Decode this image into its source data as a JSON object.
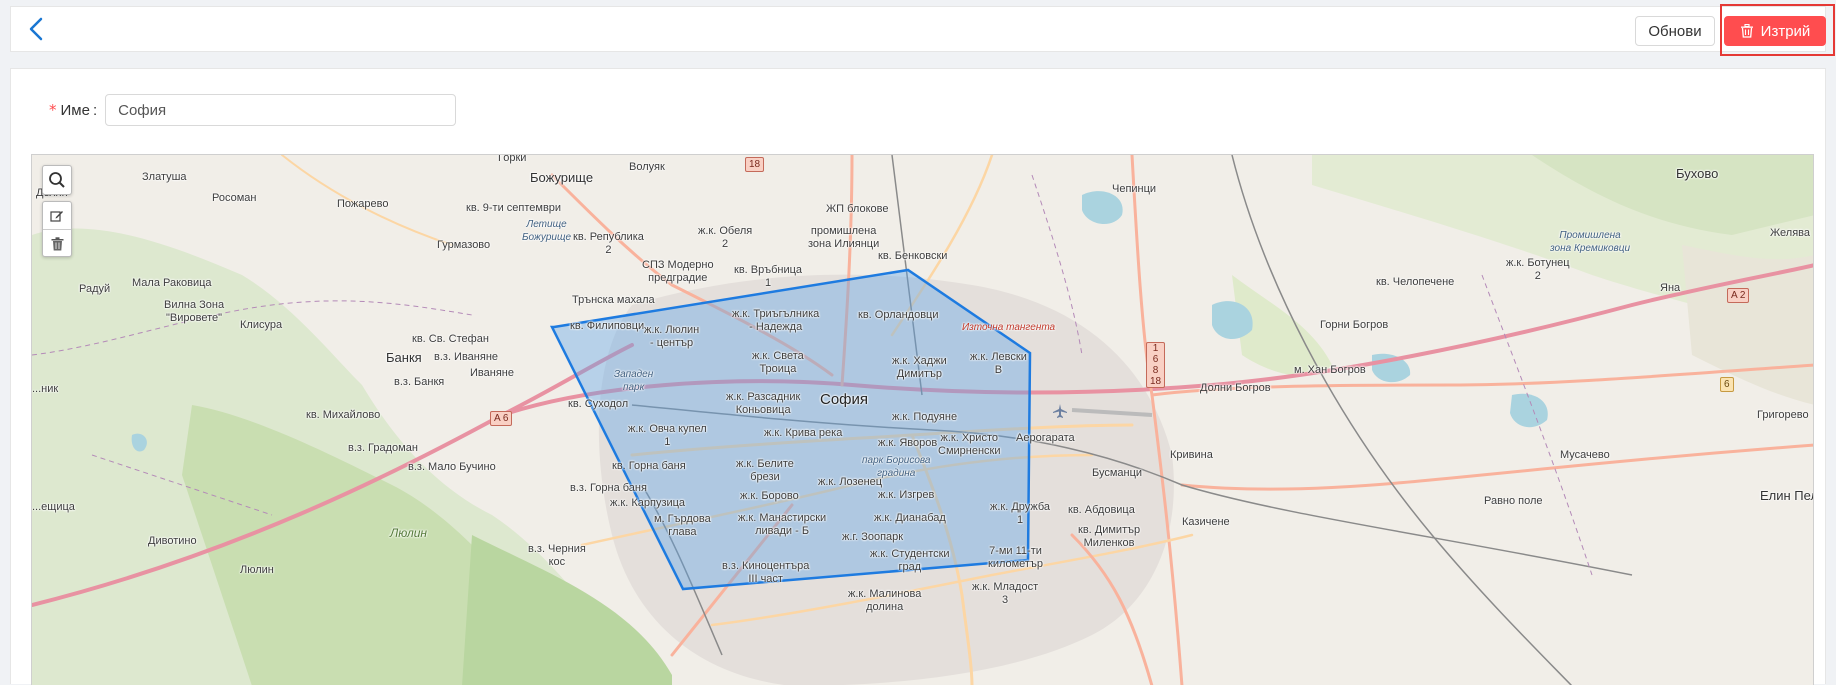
{
  "header": {
    "refresh_label": "Обнови",
    "delete_label": "Изтрий"
  },
  "form": {
    "name_label": "Име",
    "name_required_mark": "*",
    "name_value": "София"
  },
  "map": {
    "labels": {
      "gorki": "Горки",
      "volyak": "Волуяк",
      "bozhurishte": "Божурище",
      "zlatusha": "Златуша",
      "rosoman": "Росоман",
      "pozharevo": "Пожарево",
      "kv9sept": "кв. 9-ти септември",
      "letishte": "Летище\nБожурище",
      "republika": "кв. Република\n2",
      "gurmazovo": "Гурмазово",
      "delyan": "Делян",
      "malaRakovitsa": "Мала Раковица",
      "raduy": "Радуй",
      "vilnaZona": "Вилна Зона\n\"Вировете\"",
      "klisura": "Клисура",
      "trunskaMahala": "Трънска махала",
      "obelya2": "ж.к. Обеля\n2",
      "spzModerno": "СПЗ Модерно\nпредградие",
      "vrabnitsa": "кв. Връбница\n1",
      "promIliyantsi": "промишлена\nзона Илиянци",
      "zhpBlokove": "ЖП блокове",
      "benkovski": "кв. Бенковски",
      "chepintsi": "Чепинци",
      "buhovo": "Бухово",
      "zhelyava": "Желява",
      "promKremikovtsi": "Промишлена\nзона Кремиковци",
      "botunets": "ж.к. Ботунец\n2",
      "chelopechene": "кв. Челопечене",
      "yana": "Яна",
      "filipovtsi": "кв. Филиповци",
      "lyulin": "ж.к. Люлин\n- център",
      "trigalnika": "ж.к. Триъгълника\n- Надежда",
      "orlandovtsi": "кв. Орландовци",
      "iztochnaTangenta": "Източна тангента",
      "stStefan": "кв. Св. Стефан",
      "banka": "Банкя",
      "ivanyane": "в.з. Иваняне",
      "ivanyane2": "Иваняне",
      "vzBanka": "в.з. Банкя",
      "sveta": "ж.к. Света\nТроица",
      "hadzhi": "ж.к. Хаджи\nДимитър",
      "levski": "ж.к. Левски\nВ",
      "gorniBogrov": "Горни Богров",
      "hanBogrov": "м. Хан Богров",
      "zapaden": "Западен\nпарк",
      "sofia": "София",
      "razsadnik": "ж.к. Разсадник\nКоньовица",
      "suhodol": "кв. Суходол",
      "mihaylovo": "кв. Михайлово",
      "dolniBogrov": "Долни Богров",
      "grigorevo": "Григорево",
      "poduyane": "ж.к. Подуяне",
      "ovcha": "ж.к. Овча купел\n1",
      "kriva": "ж.к. Крива река",
      "yavorov": "ж.к. Яворов",
      "hristo": "ж.к. Христо\nСмирненски",
      "aerogara": "Аерогарата",
      "gradoman": "в.з. Градоман",
      "maloBuchino": "в.з. Мало Бучино",
      "gornaBanya": "кв. Горна баня",
      "beliteBrezi": "ж.к. Белите\nбрези",
      "borisova": "парк Борисова\nградина",
      "krivina": "Кривина",
      "musachevo": "Мусачево",
      "vzGornaBanya": "в.з. Горна баня",
      "lozenets": "ж.к. Лозенец",
      "izgrev": "ж.к. Изгрев",
      "busmantsi": "Бусманци",
      "karpuzitsa": "ж.к. Карпузица",
      "borovo": "ж.к. Борово",
      "druzhba": "ж.к. Дружба\n1",
      "abdovitsa": "кв. Абдовица",
      "kazichene": "Казичене",
      "ravnoPole": "Равно поле",
      "elinPelin": "Елин Пел",
      "gardova": "м. Гърдова\nглава",
      "manastirski": "ж.к. Манастирски\nливади - Б",
      "dianabad": "ж.к. Дианабад",
      "dimitarMilenkov": "кв. Димитър\nМиленков",
      "divotino": "Дивотино",
      "lyulinMtn": "Люлин",
      "chernaKos": "в.з. Черния\nкос",
      "zoopark": "ж.г. Зоопарк",
      "studentski": "ж.к. Студентски\nград",
      "sedmi": "7-ми 11-ти\nкилометър",
      "lyulinVillage": "Люлин",
      "kinotsentara": "в.з. Киноцентъра\nIII част",
      "malinova": "ж.к. Малинова\nдолина",
      "mladost3": "ж.к. Младост\n3",
      "deyalnik": "...ещица",
      "nik": "...ник"
    },
    "roads": [
      "18",
      "A 6",
      "A 2",
      "1\n6\n8\n18",
      "6"
    ]
  }
}
